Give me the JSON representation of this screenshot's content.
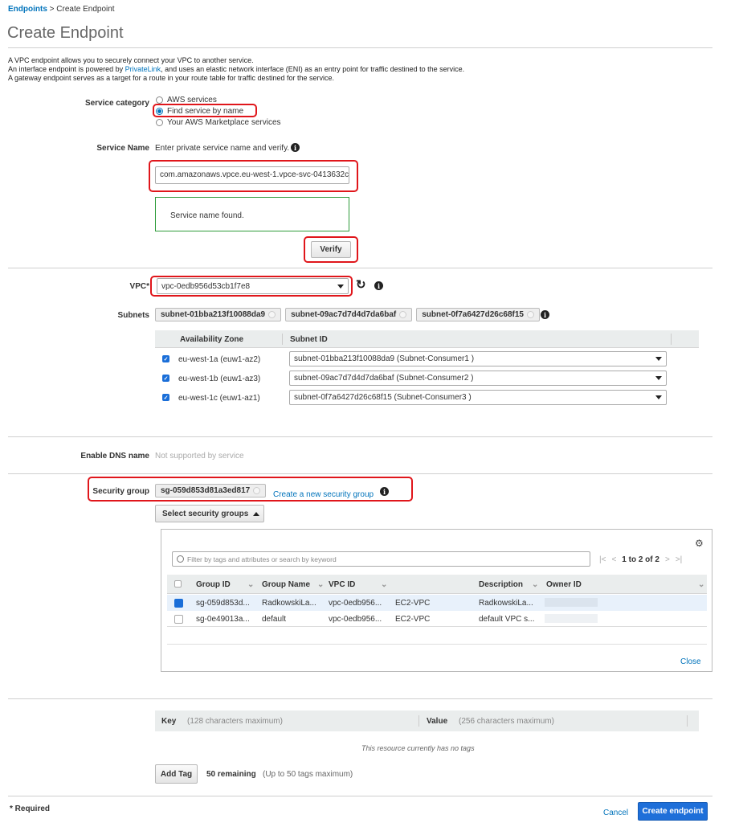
{
  "breadcrumb": {
    "parent": "Endpoints",
    "sep": ">",
    "current": "Create Endpoint"
  },
  "page_title": "Create Endpoint",
  "intro": {
    "line1": "A VPC endpoint allows you to securely connect your VPC to another service.",
    "line2_pre": "An interface endpoint is powered by ",
    "line2_link": "PrivateLink",
    "line2_post": ", and uses an elastic network interface (ENI) as an entry point for traffic destined to the service.",
    "line3": "A gateway endpoint serves as a target for a route in your route table for traffic destined for the service."
  },
  "service_category": {
    "label": "Service category",
    "options": [
      {
        "label": "AWS services",
        "selected": false
      },
      {
        "label": "Find service by name",
        "selected": true
      },
      {
        "label": "Your AWS Marketplace services",
        "selected": false
      }
    ]
  },
  "service_name": {
    "label": "Service Name",
    "hint": "Enter private service name and verify.",
    "value": "com.amazonaws.vpce.eu-west-1.vpce-svc-0413632c",
    "status": "Service name found.",
    "verify_label": "Verify"
  },
  "vpc": {
    "label": "VPC*",
    "value": "vpc-0edb956d53cb1f7e8"
  },
  "subnets": {
    "label": "Subnets",
    "chips": [
      "subnet-01bba213f10088da9",
      "subnet-09ac7d7d4d7da6baf",
      "subnet-0f7a6427d26c68f15"
    ],
    "headers": {
      "az": "Availability Zone",
      "subnet": "Subnet ID"
    },
    "rows": [
      {
        "az": "eu-west-1a (euw1-az2)",
        "subnet": "subnet-01bba213f10088da9 (Subnet-Consumer1 )"
      },
      {
        "az": "eu-west-1b (euw1-az3)",
        "subnet": "subnet-09ac7d7d4d7da6baf (Subnet-Consumer2 )"
      },
      {
        "az": "eu-west-1c (euw1-az1)",
        "subnet": "subnet-0f7a6427d26c68f15 (Subnet-Consumer3 )"
      }
    ]
  },
  "dns": {
    "label": "Enable DNS name",
    "value": "Not supported by service"
  },
  "security_group": {
    "label": "Security group",
    "chip": "sg-059d853d81a3ed817",
    "create_link": "Create a new security group",
    "select_button": "Select security groups",
    "filter_placeholder": "Filter by tags and attributes or search by keyword",
    "pagination": "1 to 2 of 2",
    "headers": {
      "group_id": "Group ID",
      "group_name": "Group Name",
      "vpc_id": "VPC ID",
      "description": "Description",
      "owner_id": "Owner ID"
    },
    "rows": [
      {
        "group_id": "sg-059d853d...",
        "group_name": "RadkowskiLa...",
        "vpc_id": "vpc-0edb956...",
        "vpc_name": "EC2-VPC",
        "description": "RadkowskiLa...",
        "selected": true
      },
      {
        "group_id": "sg-0e49013a...",
        "group_name": "default",
        "vpc_id": "vpc-0edb956...",
        "vpc_name": "EC2-VPC",
        "description": "default VPC s...",
        "selected": false
      }
    ],
    "close_label": "Close"
  },
  "tags": {
    "key_label": "Key",
    "key_hint": "(128 characters maximum)",
    "value_label": "Value",
    "value_hint": "(256 characters maximum)",
    "empty": "This resource currently has no tags",
    "add_label": "Add Tag",
    "remaining": "50 remaining",
    "remaining_hint": "(Up to 50 tags maximum)"
  },
  "footer": {
    "required": "* Required",
    "cancel": "Cancel",
    "create": "Create endpoint"
  },
  "colors": {
    "accent": "#0073bb",
    "highlight": "#e0161b",
    "primary_button": "#1e6fd9",
    "success_border": "#2e9b3a"
  }
}
